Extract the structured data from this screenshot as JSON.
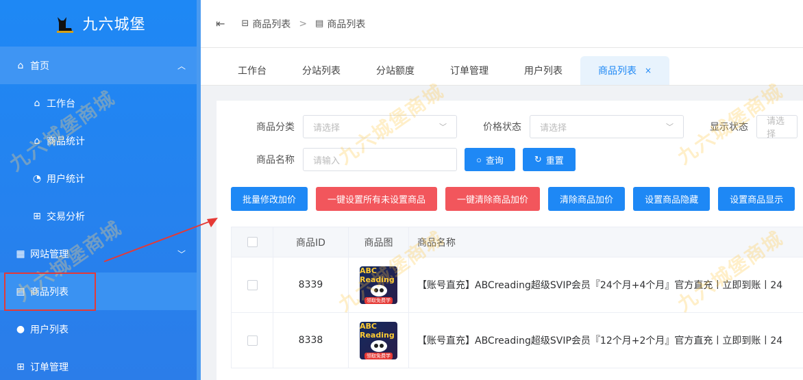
{
  "sidebar": {
    "brand": "九六城堡",
    "items": [
      {
        "label": "首页",
        "icon": "home-icon"
      },
      {
        "label": "工作台",
        "icon": "home-icon"
      },
      {
        "label": "商品统计",
        "icon": "bag-icon"
      },
      {
        "label": "用户统计",
        "icon": "pie-icon"
      },
      {
        "label": "交易分析",
        "icon": "cart-icon"
      },
      {
        "label": "网站管理",
        "icon": "building-icon"
      },
      {
        "label": "商品列表",
        "icon": "doc-icon"
      },
      {
        "label": "用户列表",
        "icon": "user-icon"
      },
      {
        "label": "订单管理",
        "icon": "cart-icon"
      }
    ]
  },
  "header": {
    "breadcrumb": [
      "商品列表",
      "商品列表"
    ]
  },
  "tabs": [
    {
      "label": "工作台"
    },
    {
      "label": "分站列表"
    },
    {
      "label": "分站额度"
    },
    {
      "label": "订单管理"
    },
    {
      "label": "用户列表"
    },
    {
      "label": "商品列表",
      "active": true,
      "close": "×"
    }
  ],
  "filters": {
    "category_label": "商品分类",
    "category_placeholder": "请选择",
    "price_label": "价格状态",
    "price_placeholder": "请选择",
    "display_label": "显示状态",
    "display_placeholder": "请选择",
    "name_label": "商品名称",
    "name_placeholder": "请输入",
    "search_label": "查询",
    "reset_label": "重置"
  },
  "actions": [
    {
      "label": "批量修改加价",
      "type": "primary"
    },
    {
      "label": "一键设置所有未设置商品",
      "type": "danger"
    },
    {
      "label": "一键清除商品加价",
      "type": "danger"
    },
    {
      "label": "清除商品加价",
      "type": "primary"
    },
    {
      "label": "设置商品隐藏",
      "type": "primary"
    },
    {
      "label": "设置商品显示",
      "type": "primary"
    }
  ],
  "table": {
    "columns": [
      "商品ID",
      "商品图",
      "商品名称"
    ],
    "rows": [
      {
        "id": "8339",
        "image_text": "ABC Reading",
        "image_tag": "领取免费学",
        "name": "【账号直充】ABCreading超级SVIP会员『24个月+4个月』官方直充丨立即到账丨24"
      },
      {
        "id": "8338",
        "image_text": "ABC Reading",
        "image_tag": "领取免费学",
        "name": "【账号直充】ABCreading超级SVIP会员『12个月+2个月』官方直充丨立即到账丨24"
      }
    ]
  },
  "watermark": "九六城堡商城",
  "colors": {
    "accent": "#1e88f5",
    "danger": "#f2565c",
    "highlight": "#e53935"
  }
}
